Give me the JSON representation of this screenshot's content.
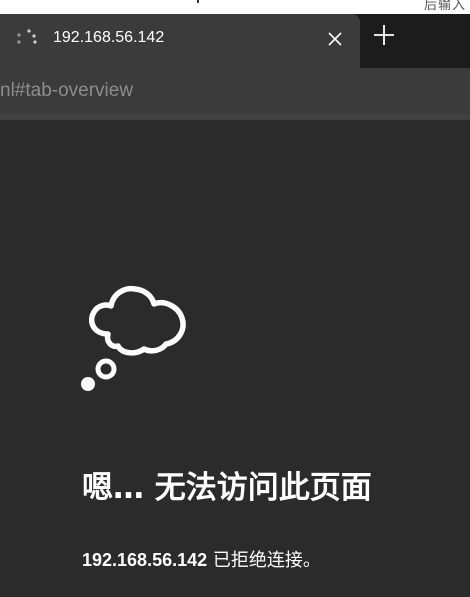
{
  "window": {
    "background_text": "后输入"
  },
  "tab": {
    "title": "192.168.56.142",
    "loading_icon": "loading-spinner-icon",
    "close_icon": "close-icon",
    "new_tab_icon": "plus-icon"
  },
  "address_bar": {
    "url_visible": "nl#tab-overview"
  },
  "error_page": {
    "icon": "thought-bubble-icon",
    "title": "嗯… 无法访问此页面",
    "host": "192.168.56.142",
    "message": " 已拒绝连接。"
  },
  "colors": {
    "tab_strip": "#1c1c1c",
    "tab_active": "#3b3b3b",
    "page_background": "#2b2b2b",
    "text": "#ffffff",
    "url_text": "#8d8d8d"
  }
}
